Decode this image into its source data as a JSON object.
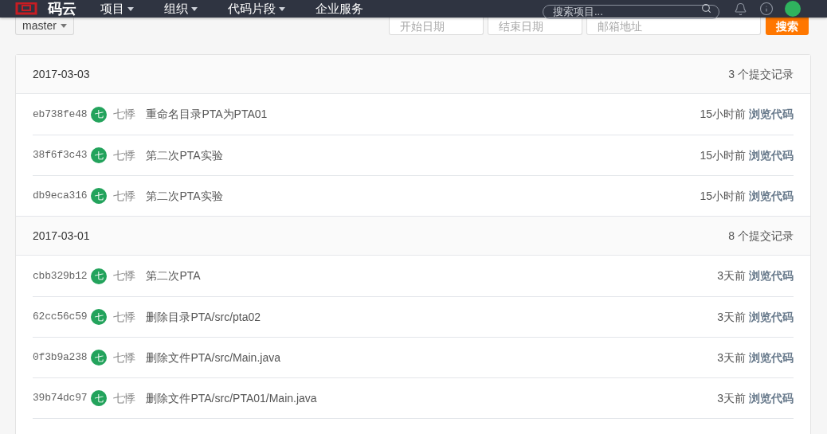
{
  "navbar": {
    "logo_text": "码云",
    "menu": [
      {
        "label": "项目",
        "caret": true
      },
      {
        "label": "组织",
        "caret": true
      },
      {
        "label": "代码片段",
        "caret": true
      },
      {
        "label": "企业服务",
        "caret": false
      }
    ],
    "search": {
      "placeholder": "搜索项目..."
    }
  },
  "filters": {
    "branch": "master",
    "start_date": {
      "placeholder": "开始日期"
    },
    "end_date": {
      "placeholder": "结束日期"
    },
    "email": {
      "placeholder": "邮箱地址"
    },
    "search_button": "搜索"
  },
  "groups": [
    {
      "date": "2017-03-03",
      "count": "3 个提交记录",
      "commits": [
        {
          "hash": "eb738fe48",
          "avatar": "七",
          "author": "七悸",
          "message": "重命名目录PTA为PTA01",
          "time": "15小时前",
          "browse": "浏览代码"
        },
        {
          "hash": "38f6f3c43",
          "avatar": "七",
          "author": "七悸",
          "message": "第二次PTA实验",
          "time": "15小时前",
          "browse": "浏览代码"
        },
        {
          "hash": "db9eca316",
          "avatar": "七",
          "author": "七悸",
          "message": "第二次PTA实验",
          "time": "15小时前",
          "browse": "浏览代码"
        }
      ]
    },
    {
      "date": "2017-03-01",
      "count": "8 个提交记录",
      "commits": [
        {
          "hash": "cbb329b12",
          "avatar": "七",
          "author": "七悸",
          "message": "第二次PTA",
          "time": "3天前",
          "browse": "浏览代码"
        },
        {
          "hash": "62cc56c59",
          "avatar": "七",
          "author": "七悸",
          "message": "删除目录PTA/src/pta02",
          "time": "3天前",
          "browse": "浏览代码"
        },
        {
          "hash": "0f3b9a238",
          "avatar": "七",
          "author": "七悸",
          "message": "删除文件PTA/src/Main.java",
          "time": "3天前",
          "browse": "浏览代码"
        },
        {
          "hash": "39b74dc97",
          "avatar": "七",
          "author": "七悸",
          "message": "删除文件PTA/src/PTA01/Main.java",
          "time": "3天前",
          "browse": "浏览代码"
        }
      ]
    }
  ]
}
